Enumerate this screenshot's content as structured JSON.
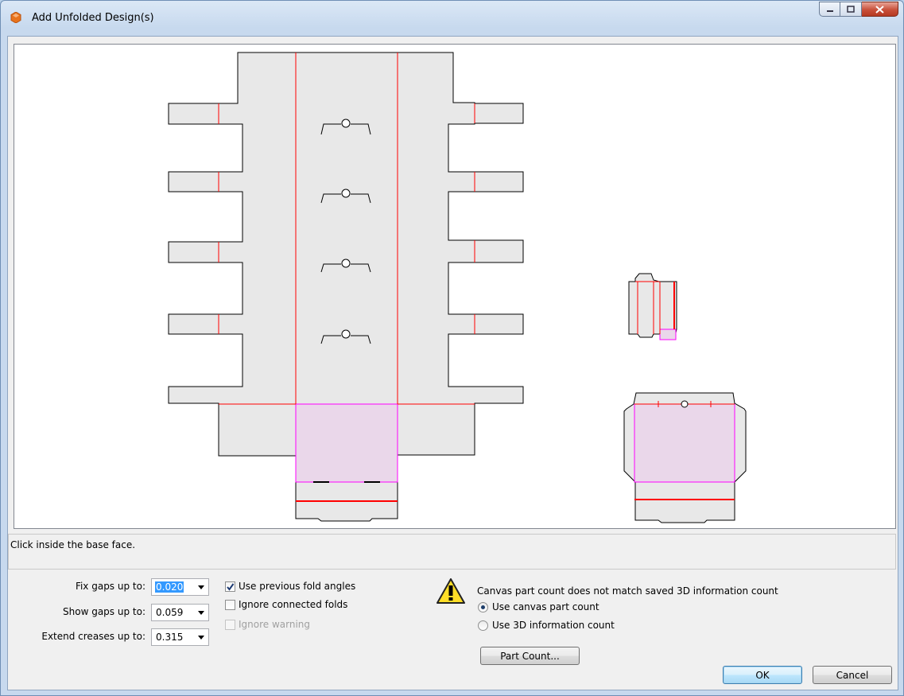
{
  "window": {
    "title": "Add Unfolded Design(s)"
  },
  "status": {
    "message": "Click inside the base face."
  },
  "gaps": {
    "fix_label": "Fix gaps up to:",
    "fix_value": "0.020",
    "show_label": "Show gaps up to:",
    "show_value": "0.059",
    "extend_label": "Extend creases up to:",
    "extend_value": "0.315"
  },
  "options": {
    "use_prev_fold_angles": "Use previous fold angles",
    "ignore_connected_folds": "Ignore connected folds",
    "ignore_warning": "Ignore warning"
  },
  "warning": {
    "message": "Canvas part count does not match saved 3D information count",
    "radio_canvas": "Use canvas part count",
    "radio_3d": "Use 3D information count"
  },
  "buttons": {
    "part_count": "Part Count...",
    "ok": "OK",
    "cancel": "Cancel"
  },
  "colors": {
    "fold_line": "#ff0000",
    "base_face_fill": "#ead7ea",
    "base_face_stroke": "#ff00ff",
    "part_fill": "#e8e8e8"
  }
}
